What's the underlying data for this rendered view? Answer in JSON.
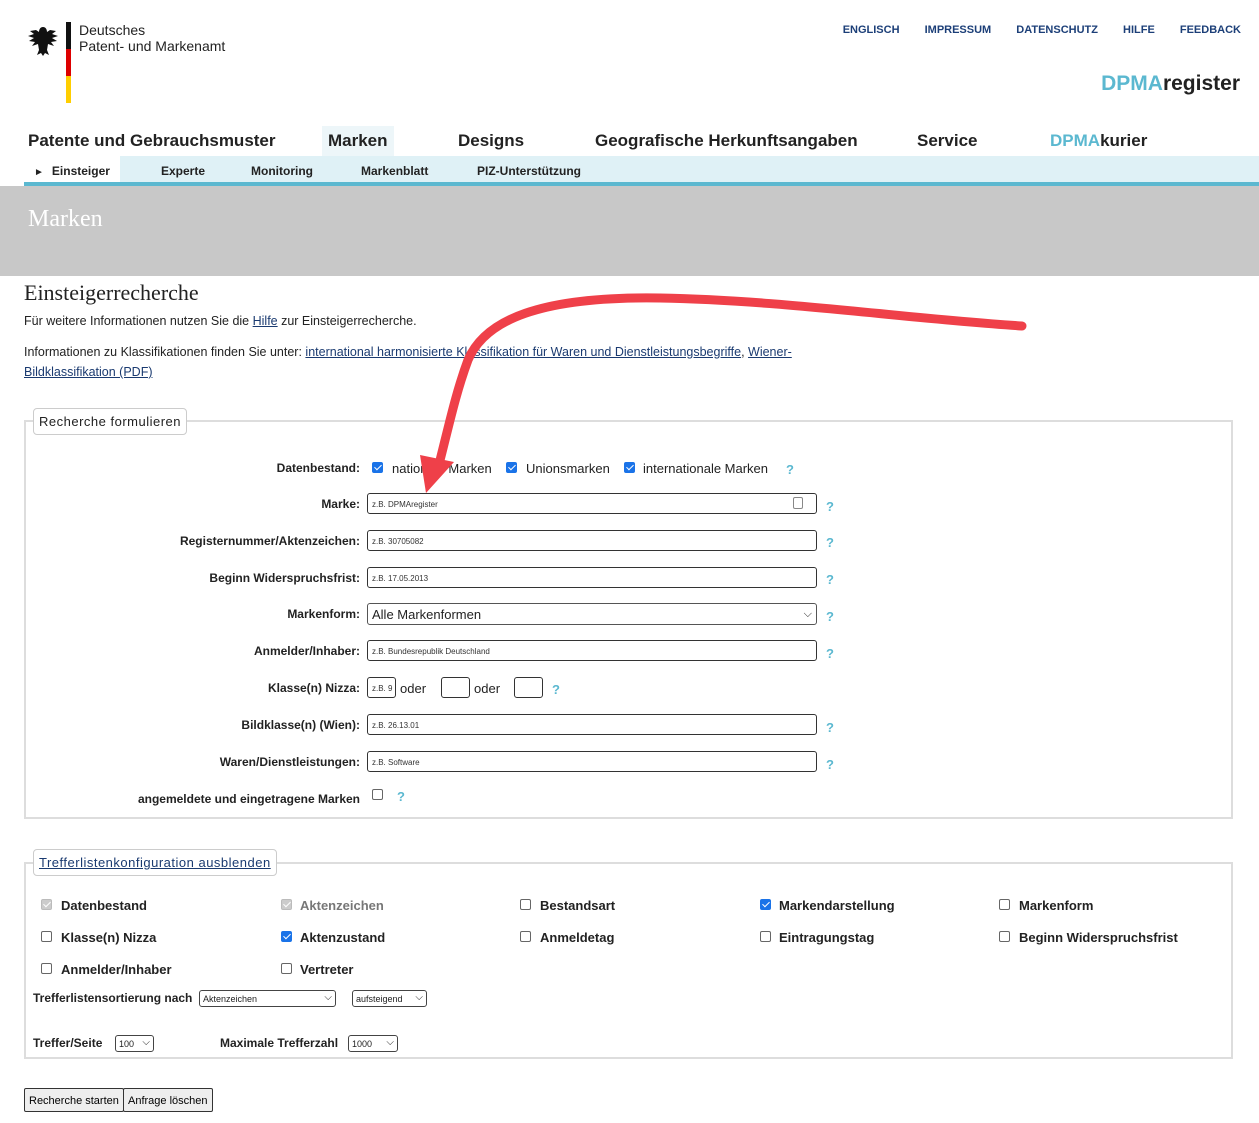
{
  "header": {
    "org_line1": "Deutsches",
    "org_line2": "Patent- und Markenamt",
    "top_links": [
      "ENGLISCH",
      "IMPRESSUM",
      "DATENSCHUTZ",
      "HILFE",
      "FEEDBACK"
    ],
    "brand_accent": "DPMA",
    "brand_rest": "register"
  },
  "main_nav": [
    "Patente und Gebrauchsmuster",
    "Marken",
    "Designs",
    "Geografische Herkunftsangaben",
    "Service"
  ],
  "kurier_accent": "DPMA",
  "kurier_rest": "kurier",
  "sub_nav": [
    "Einsteiger",
    "Experte",
    "Monitoring",
    "Markenblatt",
    "PIZ-Unterstützung"
  ],
  "sub_nav_marker": "►",
  "banner_title": "Marken",
  "page": {
    "title": "Einsteigerrecherche",
    "info1_pre": "Für weitere Informationen nutzen Sie die ",
    "info1_link": "Hilfe",
    "info1_post": " zur Einsteigerrecherche.",
    "info2_pre": "Informationen zu Klassifikationen finden Sie unter: ",
    "info2_link1": "international harmonisierte Klassifikation für Waren und Dienstleistungsbegriffe",
    "info2_sep": ", ",
    "info2_link2": "Wiener-Bildklassifikation (PDF)"
  },
  "search_form": {
    "legend": "Recherche formulieren",
    "help": "?",
    "datenbestand_label": "Datenbestand:",
    "datenbestand_options": [
      {
        "label": "nationale Marken",
        "checked": true
      },
      {
        "label": "Unionsmarken",
        "checked": true
      },
      {
        "label": "internationale Marken",
        "checked": true
      }
    ],
    "fields": [
      {
        "label": "Marke:",
        "placeholder": "z.B. DPMAregister"
      },
      {
        "label": "Registernummer/Aktenzeichen:",
        "placeholder": "z.B. 30705082"
      },
      {
        "label": "Beginn Widerspruchsfrist:",
        "placeholder": "z.B. 17.05.2013"
      }
    ],
    "markenform_label": "Markenform:",
    "markenform_value": "Alle Markenformen",
    "anmelder_label": "Anmelder/Inhaber:",
    "anmelder_placeholder": "z.B. Bundesrepublik Deutschland",
    "klasse_label": "Klasse(n) Nizza:",
    "klasse_placeholder": "z.B. 9",
    "oder": "oder",
    "bildklasse_label": "Bildklasse(n) (Wien):",
    "bildklasse_placeholder": "z.B. 26.13.01",
    "waren_label": "Waren/Dienstleistungen:",
    "waren_placeholder": "z.B. Software",
    "angemeldete_label": "angemeldete und eingetragene Marken",
    "angemeldete_checked": false
  },
  "result_config": {
    "legend": "Trefferlistenkonfiguration ausblenden",
    "columns": [
      {
        "label": "Datenbestand",
        "checked": true,
        "disabled": true
      },
      {
        "label": "Aktenzeichen",
        "checked": true,
        "disabled": true
      },
      {
        "label": "Bestandsart",
        "checked": false,
        "disabled": false
      },
      {
        "label": "Markendarstellung",
        "checked": true,
        "disabled": false
      },
      {
        "label": "Markenform",
        "checked": false,
        "disabled": false
      },
      {
        "label": "Klasse(n) Nizza",
        "checked": false,
        "disabled": false
      },
      {
        "label": "Aktenzustand",
        "checked": true,
        "disabled": false
      },
      {
        "label": "Anmeldetag",
        "checked": false,
        "disabled": false
      },
      {
        "label": "Eintragungstag",
        "checked": false,
        "disabled": false
      },
      {
        "label": "Beginn Widerspruchsfrist",
        "checked": false,
        "disabled": false
      },
      {
        "label": "Anmelder/Inhaber",
        "checked": false,
        "disabled": false
      },
      {
        "label": "Vertreter",
        "checked": false,
        "disabled": false
      }
    ],
    "sort_label": "Trefferlistensortierung nach",
    "sort_field": "Aktenzeichen",
    "sort_order": "aufsteigend",
    "per_page_label": "Treffer/Seite",
    "per_page_value": "100",
    "max_label": "Maximale Trefferzahl",
    "max_value": "1000"
  },
  "buttons": {
    "start": "Recherche starten",
    "clear": "Anfrage löschen"
  },
  "annotation_color": "#ef4049"
}
